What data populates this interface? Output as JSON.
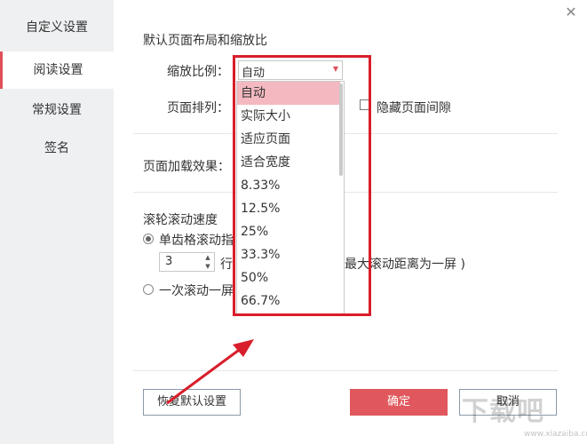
{
  "sidebar": {
    "title": "自定义设置",
    "items": [
      {
        "label": "阅读设置",
        "active": true
      },
      {
        "label": "常规设置",
        "active": false
      },
      {
        "label": "签名",
        "active": false
      }
    ]
  },
  "close_icon": "close-icon",
  "layout_section": {
    "title": "默认页面布局和缩放比",
    "zoom_label": "缩放比例：",
    "zoom_value": "自动",
    "arrange_label": "页面排列：",
    "hide_gap_label": "隐藏页面间隙"
  },
  "zoom_dropdown": {
    "options": [
      "自动",
      "实际大小",
      "适应页面",
      "适合宽度",
      "8.33%",
      "12.5%",
      "25%",
      "33.3%",
      "50%",
      "66.7%"
    ],
    "selected_index": 0
  },
  "load_section": {
    "label": "页面加载效果："
  },
  "scroll_section": {
    "title": "滚轮滚动速度",
    "option1_label": "单齿格滚动指",
    "lines_value": "3",
    "lines_unit": "行",
    "hint_text": "最大滚动距离为一屏 )",
    "option2_label": "一次滚动一屏"
  },
  "buttons": {
    "restore_default": "恢复默认设置",
    "ok": "确定",
    "cancel": "取消"
  },
  "watermark": {
    "text": "下载吧",
    "sub": "www.xiazaiba.com"
  },
  "colors": {
    "accent": "#e0505a",
    "highlight_border": "#d81e2a",
    "selected_option": "#f4b9c0",
    "sidebar_bg": "#eef0f2"
  }
}
